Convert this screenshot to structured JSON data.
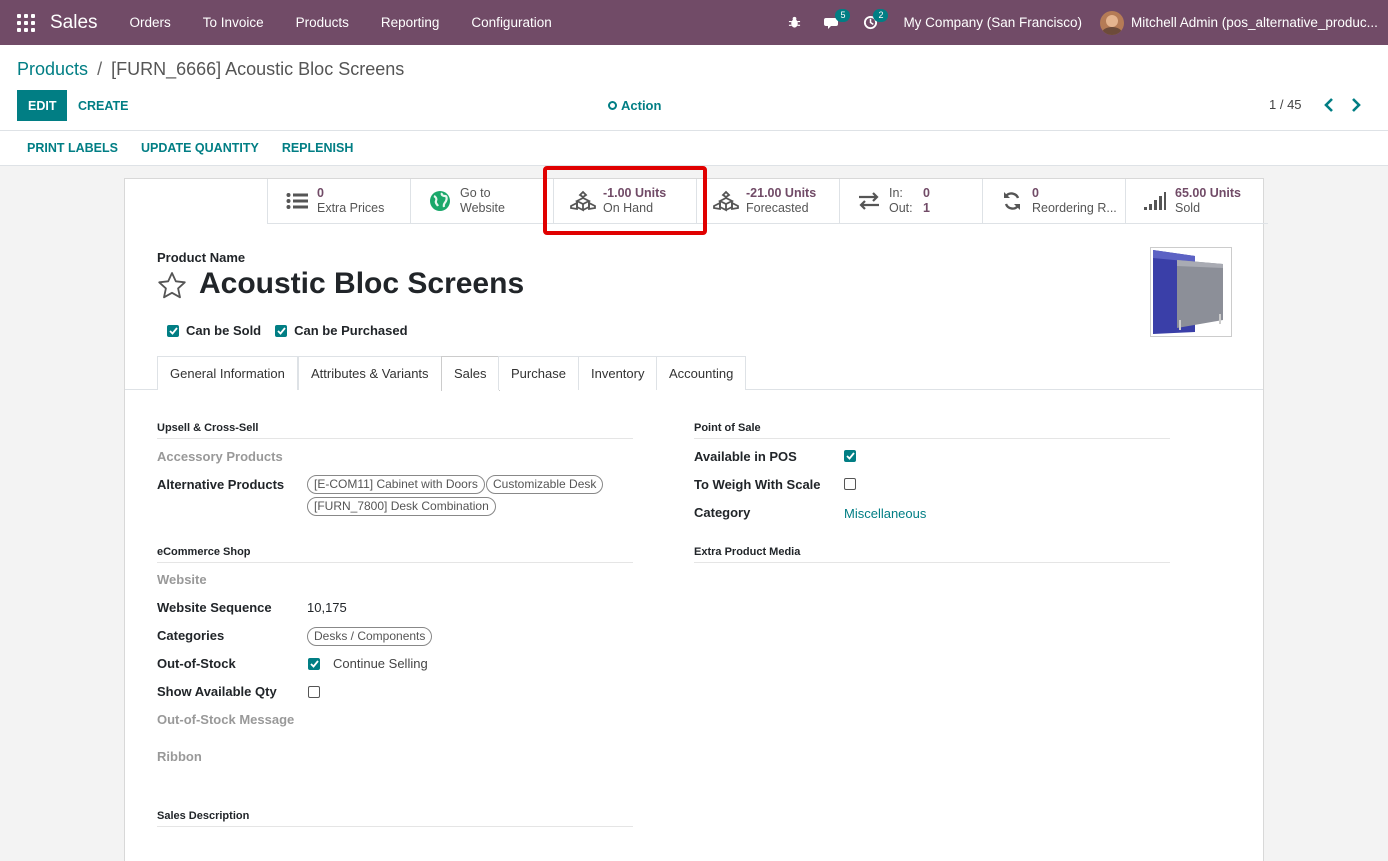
{
  "navbar": {
    "app_name": "Sales",
    "menu": [
      "Orders",
      "To Invoice",
      "Products",
      "Reporting",
      "Configuration"
    ],
    "messages_count": "5",
    "activities_count": "2",
    "company": "My Company (San Francisco)",
    "user": "Mitchell Admin (pos_alternative_produc..."
  },
  "breadcrumb": {
    "parent": "Products",
    "separator": "/",
    "current": "[FURN_6666] Acoustic Bloc Screens"
  },
  "buttons": {
    "edit": "EDIT",
    "create": "CREATE",
    "action": "Action"
  },
  "pager": {
    "value": "1 / 45"
  },
  "statusbar": {
    "print_labels": "PRINT LABELS",
    "update_quantity": "UPDATE QUANTITY",
    "replenish": "REPLENISH"
  },
  "smart_buttons": {
    "extra_prices": {
      "value": "0",
      "label": "Extra Prices"
    },
    "website": {
      "value": "Go to",
      "label": "Website"
    },
    "on_hand": {
      "value": "-1.00 Units",
      "label": "On Hand"
    },
    "forecasted": {
      "value": "-21.00 Units",
      "label": "Forecasted"
    },
    "in_out": {
      "in_label": "In:",
      "in_value": "0",
      "out_label": "Out:",
      "out_value": "1"
    },
    "reordering": {
      "value": "0",
      "label": "Reordering R..."
    },
    "sold": {
      "value": "65.00 Units",
      "label": "Sold"
    }
  },
  "product": {
    "name_label": "Product Name",
    "name": "Acoustic Bloc Screens",
    "can_be_sold": "Can be Sold",
    "can_be_purchased": "Can be Purchased"
  },
  "tabs": [
    "General Information",
    "Attributes & Variants",
    "Sales",
    "Purchase",
    "Inventory",
    "Accounting"
  ],
  "active_tab": "Sales",
  "sales": {
    "upsell_title": "Upsell & Cross-Sell",
    "accessory_label": "Accessory Products",
    "alternative_label": "Alternative Products",
    "alternative_tags": [
      "[E-COM11] Cabinet with Doors",
      "Customizable Desk",
      "[FURN_7800] Desk Combination"
    ],
    "ecommerce_title": "eCommerce Shop",
    "website_label": "Website",
    "website_sequence_label": "Website Sequence",
    "website_sequence_value": "10,175",
    "categories_label": "Categories",
    "categories_tag": "Desks / Components",
    "out_of_stock_label": "Out-of-Stock",
    "continue_selling": "Continue Selling",
    "show_qty_label": "Show Available Qty",
    "out_of_stock_msg_label": "Out-of-Stock Message",
    "ribbon_label": "Ribbon",
    "sales_desc_title": "Sales Description",
    "pos_title": "Point of Sale",
    "available_pos_label": "Available in POS",
    "weigh_label": "To Weigh With Scale",
    "category_label": "Category",
    "category_value": "Miscellaneous",
    "extra_media_title": "Extra Product Media"
  }
}
